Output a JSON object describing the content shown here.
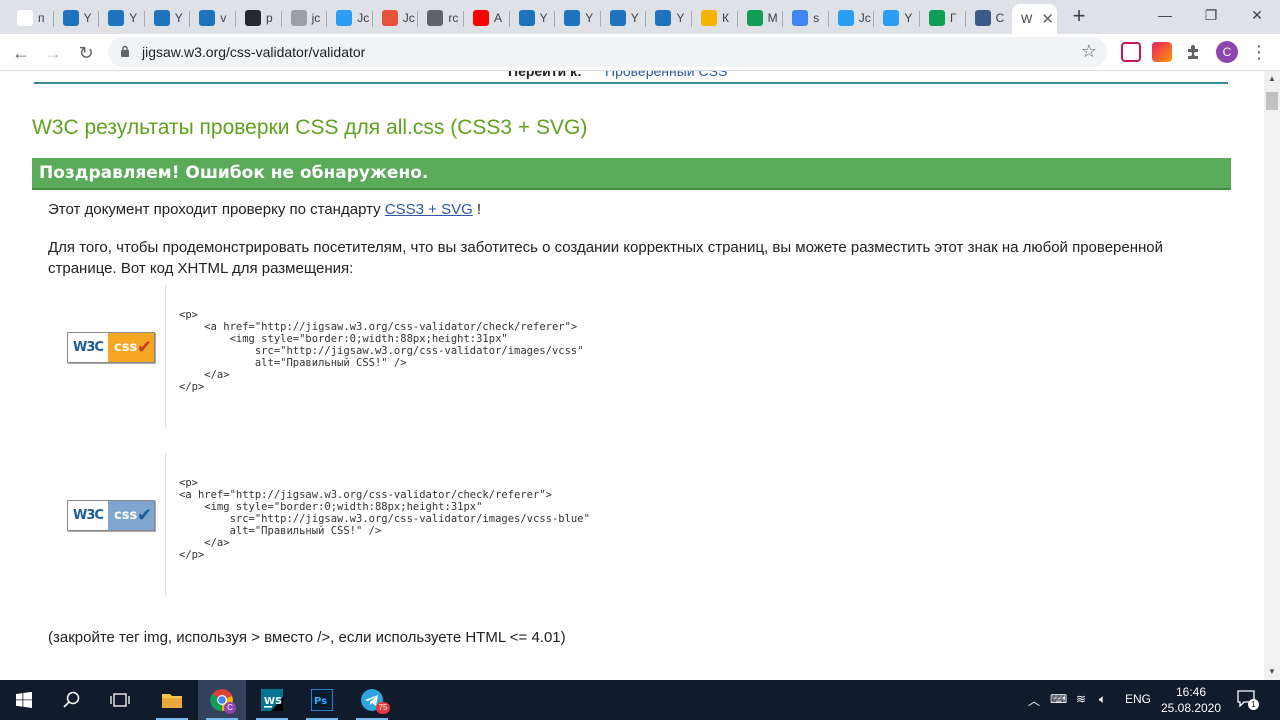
{
  "tabs": [
    {
      "label": "п",
      "icon": "google-icon",
      "color": "#ffffff"
    },
    {
      "label": "Y",
      "icon": "webstorm-icon",
      "color": "#1e73be"
    },
    {
      "label": "Y",
      "icon": "webstorm-icon",
      "color": "#1e73be"
    },
    {
      "label": "Y",
      "icon": "webstorm-icon",
      "color": "#1e73be"
    },
    {
      "label": "v",
      "icon": "webstorm-icon",
      "color": "#1e73be"
    },
    {
      "label": "p",
      "icon": "github-icon",
      "color": "#24292e"
    },
    {
      "label": "jc",
      "icon": "globe-icon",
      "color": "#9aa0a6"
    },
    {
      "label": "Jс",
      "icon": "plane-icon",
      "color": "#2a9df4"
    },
    {
      "label": "Jс",
      "icon": "rainbow-icon",
      "color": "#e5533d"
    },
    {
      "label": "rc",
      "icon": "globe-icon",
      "color": "#5f6368"
    },
    {
      "label": "А",
      "icon": "youtube-icon",
      "color": "#ff0000"
    },
    {
      "label": "Y",
      "icon": "webstorm-icon",
      "color": "#1e73be"
    },
    {
      "label": "Y",
      "icon": "webstorm-icon",
      "color": "#1e73be"
    },
    {
      "label": "Y",
      "icon": "webstorm-icon",
      "color": "#1e73be"
    },
    {
      "label": "Y",
      "icon": "webstorm-icon",
      "color": "#1e73be"
    },
    {
      "label": "К",
      "icon": "chart-icon",
      "color": "#f4b400"
    },
    {
      "label": "М",
      "icon": "drive-icon",
      "color": "#0f9d58"
    },
    {
      "label": "s",
      "icon": "docs-icon",
      "color": "#4285f4"
    },
    {
      "label": "Jс",
      "icon": "plane-icon",
      "color": "#2a9df4"
    },
    {
      "label": "Y",
      "icon": "plane-icon",
      "color": "#2a9df4"
    },
    {
      "label": "Г",
      "icon": "drive-icon",
      "color": "#0f9d58"
    },
    {
      "label": "С",
      "icon": "w3c-icon",
      "color": "#3b5a8a"
    }
  ],
  "active_tab": {
    "label": "W",
    "close": "✕"
  },
  "new_tab": "+",
  "window": {
    "minimize": "—",
    "restore": "❐",
    "close": "✕"
  },
  "toolbar": {
    "url": "jigsaw.w3.org/css-validator/validator",
    "back": "←",
    "forward": "→",
    "reload": "↻",
    "star": "☆",
    "profile": "С",
    "menu": "⋮"
  },
  "page": {
    "nav_label": "Перейти к:",
    "nav_link": "Проверенный CSS",
    "title": "W3C результаты проверки CSS для all.css (CSS3 + SVG)",
    "congrats": "Поздравляем! Ошибок не обнаружено.",
    "p1_before": "Этот документ проходит проверку по стандарту ",
    "p1_link": "CSS3 + SVG",
    "p1_after": " !",
    "p2": "Для того, чтобы продемонстрировать посетителям, что вы заботитесь о создании корректных страниц, вы можете разместить этот знак на любой проверенной странице. Вот код XHTML для размещения:",
    "badge1": {
      "w3c": "W3C",
      "css": "css",
      "check": "✔",
      "check_color": "#c0392b",
      "bg": "#f5a623"
    },
    "badge2": {
      "w3c": "W3C",
      "css": "css",
      "check": "✔",
      "check_color": "#1a5a96",
      "bg": "#7ea6cf"
    },
    "code1": "<p>\n    <a href=\"http://jigsaw.w3.org/css-validator/check/referer\">\n        <img style=\"border:0;width:88px;height:31px\"\n            src=\"http://jigsaw.w3.org/css-validator/images/vcss\"\n            alt=\"Правильный CSS!\" />\n    </a>\n</p>",
    "code2": "<p>\n<a href=\"http://jigsaw.w3.org/css-validator/check/referer\">\n    <img style=\"border:0;width:88px;height:31px\"\n        src=\"http://jigsaw.w3.org/css-validator/images/vcss-blue\"\n        alt=\"Правильный CSS!\" />\n    </a>\n</p>",
    "closing": "(закройте тег img, используя > вместо />, если используете HTML <= 4.01)"
  },
  "taskbar": {
    "apps": [
      "windows-start-icon",
      "search-icon",
      "task-view-icon",
      "file-explorer-icon",
      "chrome-icon",
      "webstorm-icon",
      "photoshop-icon",
      "telegram-icon"
    ],
    "telegram_badge": "75",
    "chrome_badge": "C",
    "lang": "ENG",
    "time": "16:46",
    "date": "25.08.2020",
    "notification_count": "1"
  }
}
